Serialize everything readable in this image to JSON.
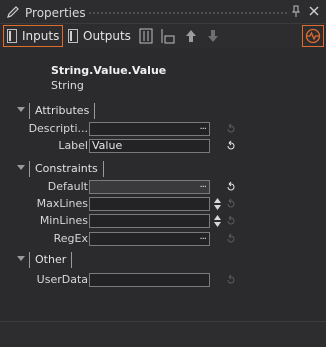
{
  "window": {
    "title": "Properties",
    "icons": {
      "app": "pencil-icon",
      "pin": "pin-icon",
      "close": "close-icon"
    }
  },
  "toolbar": {
    "inputs_label": "Inputs",
    "outputs_label": "Outputs",
    "icons": [
      "columns-icon",
      "layout-icon",
      "arrow-up-icon",
      "arrow-down-icon",
      "monitor-icon"
    ],
    "accent": "#e06c2c"
  },
  "node": {
    "name": "String.Value.Value",
    "type": "String"
  },
  "groups": {
    "attributes": {
      "label": "Attributes",
      "props": {
        "description": {
          "label": "Descripti...",
          "value": "",
          "button": "..."
        },
        "label": {
          "label": "Label",
          "value": "Value"
        }
      }
    },
    "constraints": {
      "label": "Constraints",
      "props": {
        "default": {
          "label": "Default",
          "value": "",
          "button": "..."
        },
        "maxlines": {
          "label": "MaxLines",
          "value": ""
        },
        "minlines": {
          "label": "MinLines",
          "value": ""
        },
        "regex": {
          "label": "RegEx",
          "value": "",
          "button": "..."
        }
      }
    },
    "other": {
      "label": "Other",
      "props": {
        "userdata": {
          "label": "UserData",
          "value": ""
        }
      }
    }
  }
}
